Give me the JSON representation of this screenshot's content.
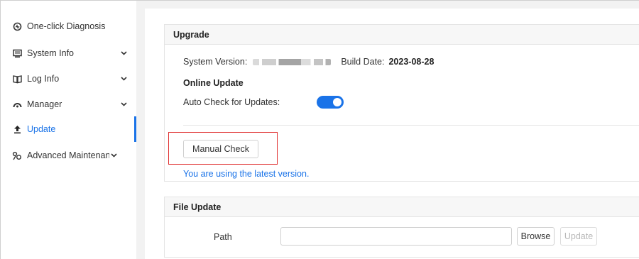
{
  "sidebar": {
    "items": [
      {
        "label": "One-click Diagnosis",
        "icon": "diagnosis-icon",
        "expandable": false,
        "active": false
      },
      {
        "label": "System Info",
        "icon": "monitor-icon",
        "expandable": true,
        "active": false
      },
      {
        "label": "Log Info",
        "icon": "book-icon",
        "expandable": true,
        "active": false
      },
      {
        "label": "Manager",
        "icon": "gauge-icon",
        "expandable": true,
        "active": false
      },
      {
        "label": "Update",
        "icon": "upload-icon",
        "expandable": false,
        "active": true
      },
      {
        "label": "Advanced Maintenan...",
        "icon": "maintenance-icon",
        "expandable": true,
        "active": false
      }
    ]
  },
  "upgrade": {
    "title": "Upgrade",
    "system_version_label": "System Version:",
    "build_date_label": "Build Date:",
    "build_date_value": "2023-08-28",
    "online_update_title": "Online Update",
    "auto_check_label": "Auto Check for Updates:",
    "auto_check_enabled": true,
    "manual_check_label": "Manual Check",
    "status_message": "You are using the latest version."
  },
  "file_update": {
    "title": "File Update",
    "path_label": "Path",
    "path_value": "",
    "browse_label": "Browse",
    "update_label": "Update",
    "update_disabled": true
  },
  "colors": {
    "accent": "#1a73e8",
    "highlight": "#e03131"
  }
}
